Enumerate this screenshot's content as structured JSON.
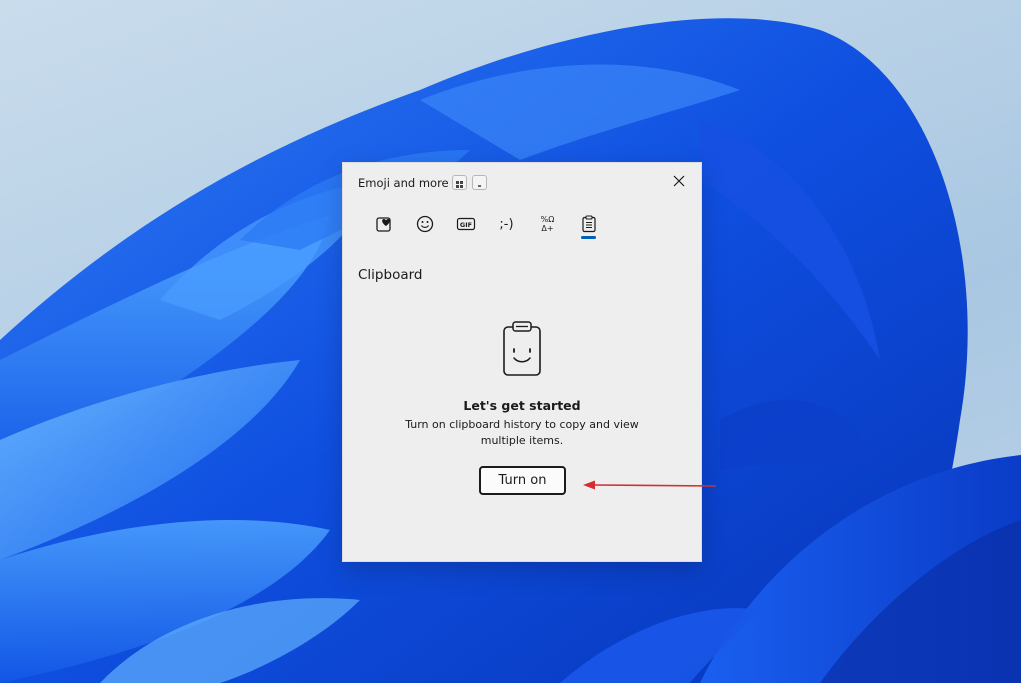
{
  "panel": {
    "title": "Emoji and more",
    "title_icons": [
      "grid-layout-icon",
      "small-mode-icon"
    ],
    "close_icon": "close-icon"
  },
  "tabs": [
    {
      "name": "favorites",
      "icon": "heart-emoji-icon"
    },
    {
      "name": "emoji",
      "icon": "smiley-icon"
    },
    {
      "name": "gif",
      "icon": "gif-icon",
      "label": "GIF"
    },
    {
      "name": "kaomoji",
      "icon": "kaomoji-icon",
      "label": ";-)"
    },
    {
      "name": "symbols",
      "icon": "symbols-icon",
      "label": "%Ω Δ+"
    },
    {
      "name": "clipboard",
      "icon": "clipboard-icon",
      "active": true
    }
  ],
  "clipboard": {
    "heading": "Clipboard",
    "empty_title": "Let's get started",
    "empty_description": "Turn on clipboard history to copy and view multiple items.",
    "button_label": "Turn on"
  },
  "colors": {
    "accent": "#005fb8",
    "annotation_arrow": "#d32f2f",
    "panel_bg": "#eeeeee"
  }
}
